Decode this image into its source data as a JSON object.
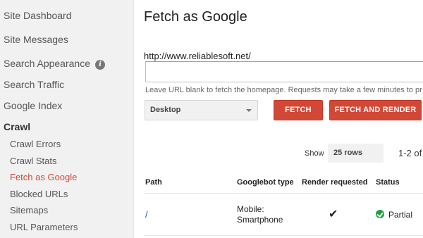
{
  "sidebar": {
    "items": [
      {
        "label": "Site Dashboard"
      },
      {
        "label": "Site Messages"
      },
      {
        "label": "Search Appearance"
      },
      {
        "label": "Search Traffic"
      },
      {
        "label": "Google Index"
      },
      {
        "label": "Crawl"
      }
    ],
    "crawl_items": [
      {
        "label": "Crawl Errors"
      },
      {
        "label": "Crawl Stats"
      },
      {
        "label": "Fetch as Google",
        "active": true
      },
      {
        "label": "Blocked URLs"
      },
      {
        "label": "Sitemaps"
      },
      {
        "label": "URL Parameters"
      }
    ],
    "info_icon": "info-icon"
  },
  "main": {
    "title": "Fetch as Google",
    "site_url": "http://www.reliablesoft.net/",
    "url_input_value": "",
    "hint": "Leave URL blank to fetch the homepage. Requests may take a few minutes to pr",
    "device_selected": "Desktop",
    "fetch_label": "FETCH",
    "fetch_render_label": "FETCH AND RENDER",
    "show_label": "Show",
    "rows_selected": "25 rows",
    "pager": "1-2 of"
  },
  "table": {
    "headers": [
      "Path",
      "Googlebot type",
      "Render requested",
      "Status"
    ],
    "rows": [
      {
        "path": "/",
        "googlebot_type": "Mobile: Smartphone",
        "render_requested": "✔",
        "status": "Partial"
      }
    ]
  },
  "colors": {
    "accent_red": "#d14836",
    "link_blue": "#1155cc",
    "status_green": "#1e9e3e",
    "sidebar_bg": "#f1f1f1"
  }
}
